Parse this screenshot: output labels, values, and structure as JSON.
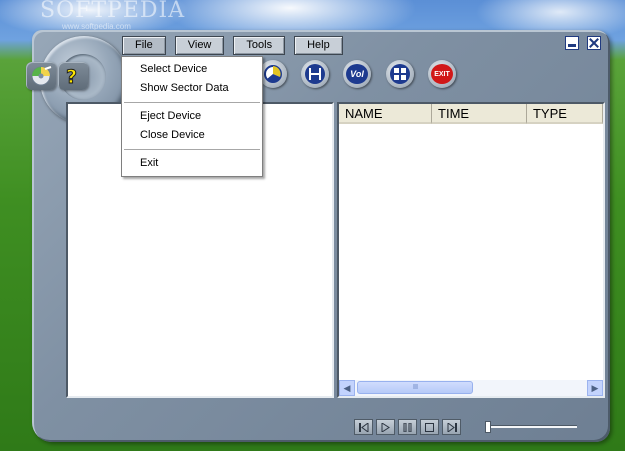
{
  "watermark": {
    "text": "SOFTPEDIA",
    "sub": "www.softpedia.com"
  },
  "menubar": {
    "items": [
      {
        "label": "File"
      },
      {
        "label": "View"
      },
      {
        "label": "Tools"
      },
      {
        "label": "Help"
      }
    ]
  },
  "file_menu": {
    "items": [
      {
        "label": "Select Device"
      },
      {
        "label": "Show Sector Data"
      },
      {
        "label": "Eject Device"
      },
      {
        "label": "Close Device"
      },
      {
        "label": "Exit"
      }
    ]
  },
  "toolbar": {
    "buttons": [
      {
        "icon": "cd-disc-icon"
      },
      {
        "icon": "question-mark-icon"
      },
      {
        "icon": "chart-icon"
      },
      {
        "icon": "floppy-disk-icon"
      },
      {
        "icon": "volume-icon",
        "label": "Vol"
      },
      {
        "icon": "grid-icon"
      },
      {
        "icon": "exit-icon",
        "label": "EXIT"
      }
    ]
  },
  "file_list": {
    "columns": [
      "NAME",
      "TIME",
      "TYPE"
    ],
    "rows": []
  },
  "scrollbar": {
    "thumb_grip": "IIIII"
  },
  "colors": {
    "skin": "#7f90a3",
    "exit_red": "#d11818",
    "icon_blue": "#1d3a8f"
  }
}
